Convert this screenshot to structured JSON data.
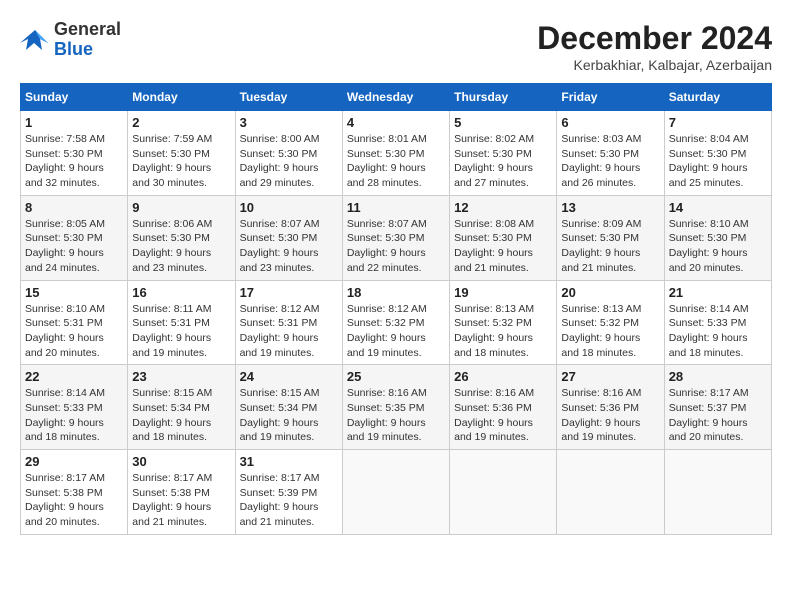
{
  "logo": {
    "general": "General",
    "blue": "Blue"
  },
  "header": {
    "month_year": "December 2024",
    "location": "Kerbakhiar, Kalbajar, Azerbaijan"
  },
  "weekdays": [
    "Sunday",
    "Monday",
    "Tuesday",
    "Wednesday",
    "Thursday",
    "Friday",
    "Saturday"
  ],
  "weeks": [
    [
      {
        "day": 1,
        "sunrise": "7:58 AM",
        "sunset": "5:30 PM",
        "daylight": "9 hours and 32 minutes"
      },
      {
        "day": 2,
        "sunrise": "7:59 AM",
        "sunset": "5:30 PM",
        "daylight": "9 hours and 30 minutes"
      },
      {
        "day": 3,
        "sunrise": "8:00 AM",
        "sunset": "5:30 PM",
        "daylight": "9 hours and 29 minutes"
      },
      {
        "day": 4,
        "sunrise": "8:01 AM",
        "sunset": "5:30 PM",
        "daylight": "9 hours and 28 minutes"
      },
      {
        "day": 5,
        "sunrise": "8:02 AM",
        "sunset": "5:30 PM",
        "daylight": "9 hours and 27 minutes"
      },
      {
        "day": 6,
        "sunrise": "8:03 AM",
        "sunset": "5:30 PM",
        "daylight": "9 hours and 26 minutes"
      },
      {
        "day": 7,
        "sunrise": "8:04 AM",
        "sunset": "5:30 PM",
        "daylight": "9 hours and 25 minutes"
      }
    ],
    [
      {
        "day": 8,
        "sunrise": "8:05 AM",
        "sunset": "5:30 PM",
        "daylight": "9 hours and 24 minutes"
      },
      {
        "day": 9,
        "sunrise": "8:06 AM",
        "sunset": "5:30 PM",
        "daylight": "9 hours and 23 minutes"
      },
      {
        "day": 10,
        "sunrise": "8:07 AM",
        "sunset": "5:30 PM",
        "daylight": "9 hours and 23 minutes"
      },
      {
        "day": 11,
        "sunrise": "8:07 AM",
        "sunset": "5:30 PM",
        "daylight": "9 hours and 22 minutes"
      },
      {
        "day": 12,
        "sunrise": "8:08 AM",
        "sunset": "5:30 PM",
        "daylight": "9 hours and 21 minutes"
      },
      {
        "day": 13,
        "sunrise": "8:09 AM",
        "sunset": "5:30 PM",
        "daylight": "9 hours and 21 minutes"
      },
      {
        "day": 14,
        "sunrise": "8:10 AM",
        "sunset": "5:30 PM",
        "daylight": "9 hours and 20 minutes"
      }
    ],
    [
      {
        "day": 15,
        "sunrise": "8:10 AM",
        "sunset": "5:31 PM",
        "daylight": "9 hours and 20 minutes"
      },
      {
        "day": 16,
        "sunrise": "8:11 AM",
        "sunset": "5:31 PM",
        "daylight": "9 hours and 19 minutes"
      },
      {
        "day": 17,
        "sunrise": "8:12 AM",
        "sunset": "5:31 PM",
        "daylight": "9 hours and 19 minutes"
      },
      {
        "day": 18,
        "sunrise": "8:12 AM",
        "sunset": "5:32 PM",
        "daylight": "9 hours and 19 minutes"
      },
      {
        "day": 19,
        "sunrise": "8:13 AM",
        "sunset": "5:32 PM",
        "daylight": "9 hours and 18 minutes"
      },
      {
        "day": 20,
        "sunrise": "8:13 AM",
        "sunset": "5:32 PM",
        "daylight": "9 hours and 18 minutes"
      },
      {
        "day": 21,
        "sunrise": "8:14 AM",
        "sunset": "5:33 PM",
        "daylight": "9 hours and 18 minutes"
      }
    ],
    [
      {
        "day": 22,
        "sunrise": "8:14 AM",
        "sunset": "5:33 PM",
        "daylight": "9 hours and 18 minutes"
      },
      {
        "day": 23,
        "sunrise": "8:15 AM",
        "sunset": "5:34 PM",
        "daylight": "9 hours and 18 minutes"
      },
      {
        "day": 24,
        "sunrise": "8:15 AM",
        "sunset": "5:34 PM",
        "daylight": "9 hours and 19 minutes"
      },
      {
        "day": 25,
        "sunrise": "8:16 AM",
        "sunset": "5:35 PM",
        "daylight": "9 hours and 19 minutes"
      },
      {
        "day": 26,
        "sunrise": "8:16 AM",
        "sunset": "5:36 PM",
        "daylight": "9 hours and 19 minutes"
      },
      {
        "day": 27,
        "sunrise": "8:16 AM",
        "sunset": "5:36 PM",
        "daylight": "9 hours and 19 minutes"
      },
      {
        "day": 28,
        "sunrise": "8:17 AM",
        "sunset": "5:37 PM",
        "daylight": "9 hours and 20 minutes"
      }
    ],
    [
      {
        "day": 29,
        "sunrise": "8:17 AM",
        "sunset": "5:38 PM",
        "daylight": "9 hours and 20 minutes"
      },
      {
        "day": 30,
        "sunrise": "8:17 AM",
        "sunset": "5:38 PM",
        "daylight": "9 hours and 21 minutes"
      },
      {
        "day": 31,
        "sunrise": "8:17 AM",
        "sunset": "5:39 PM",
        "daylight": "9 hours and 21 minutes"
      },
      null,
      null,
      null,
      null
    ]
  ]
}
